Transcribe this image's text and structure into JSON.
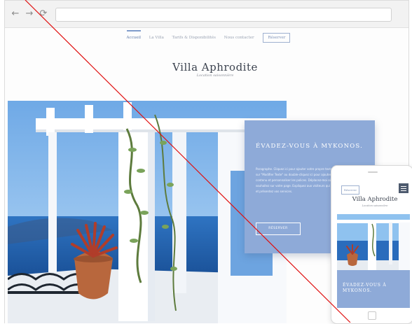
{
  "browser": {
    "nav_back": "←",
    "nav_forward": "→",
    "nav_reload": "⟳",
    "url": ""
  },
  "site": {
    "nav_items": [
      "Accueil",
      "La Villa",
      "Tarifs & Disponibilités",
      "Nous contacter"
    ],
    "reserve_label": "Réserver",
    "title": "Villa Aphrodite",
    "subtitle": "Location saisonnière"
  },
  "promo": {
    "heading": "ÉVADEZ-VOUS À MYKONOS.",
    "text": "Paragraphe. Cliquez ici pour ajouter votre propre texte. Cliquez sur \"Modifier Texte\" ou double-cliquez ici pour ajouter votre contenu et personnaliser les polices. Déplacez-moi où vous le souhaitez sur votre page. Expliquez aux visiteurs qui vous êtes et présentez vos services.",
    "button_label": "RÉSERVER"
  },
  "mobile": {
    "reserve_label": "Réserver",
    "title": "Villa Aphrodite",
    "subtitle": "Location saisonnière",
    "promo_heading": "ÉVADEZ-VOUS À MYKONOS."
  },
  "colors": {
    "accent_blue": "#8eaad8",
    "title_text": "#3d4450",
    "overlay_line": "#e01010"
  },
  "icons": {
    "back": "arrow-left-icon",
    "forward": "arrow-right-icon",
    "reload": "reload-icon",
    "menu": "hamburger-menu-icon"
  }
}
